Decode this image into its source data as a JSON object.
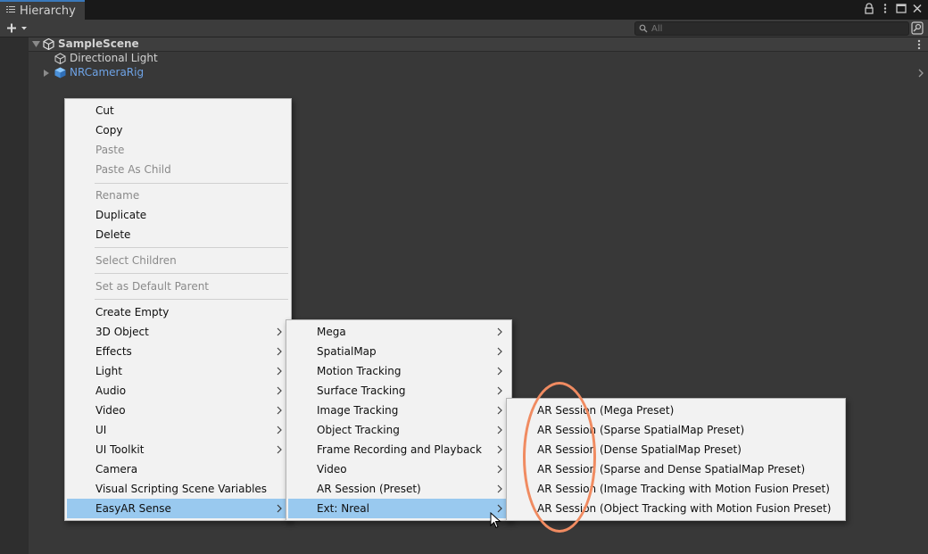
{
  "panel": {
    "tab_label": "Hierarchy",
    "search_placeholder": "All"
  },
  "hierarchy": {
    "scene_name": "SampleScene",
    "items": [
      {
        "label": "Directional Light",
        "color": "#d2d2d2",
        "icon": "cube-outline-icon"
      },
      {
        "label": "NRCameraRig",
        "color": "#6ea3e6",
        "icon": "prefab-cube-icon"
      }
    ]
  },
  "context_menu": {
    "items": [
      {
        "label": "Cut",
        "enabled": true
      },
      {
        "label": "Copy",
        "enabled": true
      },
      {
        "label": "Paste",
        "enabled": false
      },
      {
        "label": "Paste As Child",
        "enabled": false
      },
      {
        "label": "Rename",
        "enabled": false
      },
      {
        "label": "Duplicate",
        "enabled": true
      },
      {
        "label": "Delete",
        "enabled": true
      },
      {
        "label": "Select Children",
        "enabled": false
      },
      {
        "label": "Set as Default Parent",
        "enabled": false
      },
      {
        "label": "Create Empty",
        "enabled": true
      },
      {
        "label": "3D Object",
        "enabled": true,
        "submenu": true
      },
      {
        "label": "Effects",
        "enabled": true,
        "submenu": true
      },
      {
        "label": "Light",
        "enabled": true,
        "submenu": true
      },
      {
        "label": "Audio",
        "enabled": true,
        "submenu": true
      },
      {
        "label": "Video",
        "enabled": true,
        "submenu": true
      },
      {
        "label": "UI",
        "enabled": true,
        "submenu": true
      },
      {
        "label": "UI Toolkit",
        "enabled": true,
        "submenu": true
      },
      {
        "label": "Camera",
        "enabled": true
      },
      {
        "label": "Visual Scripting Scene Variables",
        "enabled": true
      },
      {
        "label": "EasyAR Sense",
        "enabled": true,
        "submenu": true,
        "selected": true
      }
    ]
  },
  "easyar_menu": {
    "items": [
      {
        "label": "Mega"
      },
      {
        "label": "SpatialMap"
      },
      {
        "label": "Motion Tracking"
      },
      {
        "label": "Surface Tracking"
      },
      {
        "label": "Image Tracking"
      },
      {
        "label": "Object Tracking"
      },
      {
        "label": "Frame Recording and Playback"
      },
      {
        "label": "Video"
      },
      {
        "label": "AR Session (Preset)"
      },
      {
        "label": "Ext: Nreal",
        "selected": true
      }
    ]
  },
  "nreal_menu": {
    "items": [
      {
        "label": "AR Session (Mega Preset)"
      },
      {
        "label": "AR Session (Sparse SpatialMap Preset)"
      },
      {
        "label": "AR Session (Dense SpatialMap Preset)"
      },
      {
        "label": "AR Session (Sparse and Dense SpatialMap Preset)"
      },
      {
        "label": "AR Session (Image Tracking with Motion Fusion Preset)"
      },
      {
        "label": "AR Session (Object Tracking with Motion Fusion Preset)"
      }
    ]
  },
  "colors": {
    "menu_highlight": "#99c9ef",
    "annotation": "#f08b61",
    "prefab_text": "#6ea3e6"
  }
}
